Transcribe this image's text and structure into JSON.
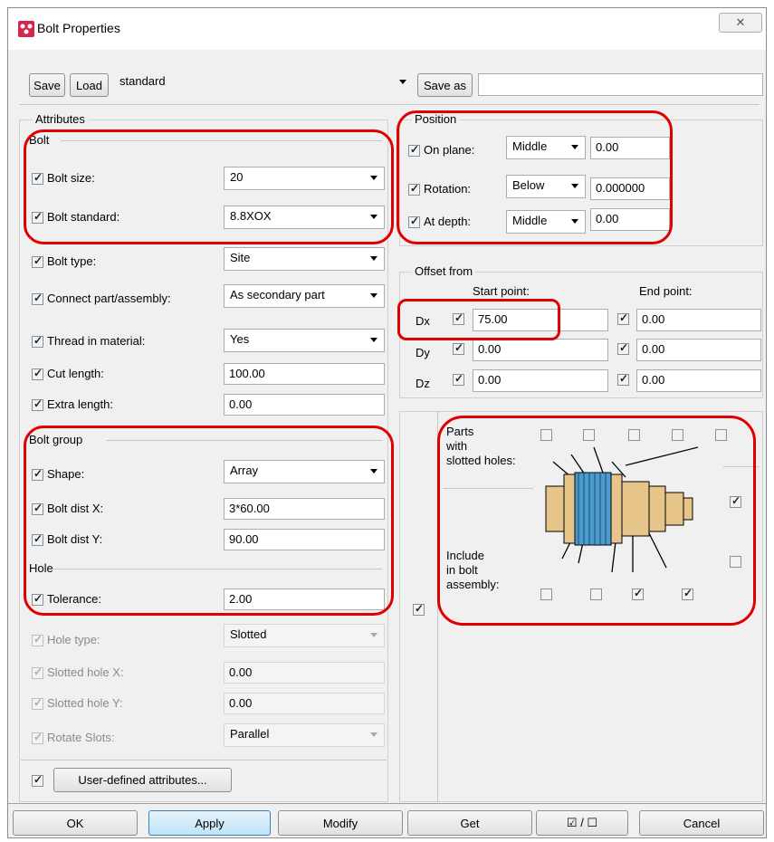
{
  "window": {
    "title": "Bolt Properties",
    "close_glyph": "✕"
  },
  "topbar": {
    "save": "Save",
    "load": "Load",
    "preset": "standard",
    "save_as": "Save as",
    "save_as_value": ""
  },
  "attributes": {
    "heading": "Attributes",
    "bolt_heading": "Bolt",
    "bolt_size_label": "Bolt size:",
    "bolt_size": "20",
    "bolt_standard_label": "Bolt standard:",
    "bolt_standard": "8.8XOX",
    "bolt_type_label": "Bolt type:",
    "bolt_type": "Site",
    "connect_label": "Connect part/assembly:",
    "connect": "As secondary part",
    "thread_label": "Thread in material:",
    "thread": "Yes",
    "cut_length_label": "Cut length:",
    "cut_length": "100.00",
    "extra_length_label": "Extra length:",
    "extra_length": "0.00",
    "group_heading": "Bolt group",
    "shape_label": "Shape:",
    "shape": "Array",
    "dist_x_label": "Bolt dist X:",
    "dist_x": "3*60.00",
    "dist_y_label": "Bolt dist Y:",
    "dist_y": "90.00",
    "hole_heading": "Hole",
    "tolerance_label": "Tolerance:",
    "tolerance": "2.00",
    "hole_type_label": "Hole type:",
    "hole_type": "Slotted",
    "slotted_x_label": "Slotted hole X:",
    "slotted_x": "0.00",
    "slotted_y_label": "Slotted hole Y:",
    "slotted_y": "0.00",
    "rotate_label": "Rotate Slots:",
    "rotate": "Parallel",
    "uda_button": "User-defined attributes..."
  },
  "position": {
    "heading": "Position",
    "on_plane_label": "On plane:",
    "on_plane": "Middle",
    "on_plane_value": "0.00",
    "rotation_label": "Rotation:",
    "rotation": "Below",
    "rotation_value": "0.000000",
    "at_depth_label": "At depth:",
    "at_depth": "Middle",
    "at_depth_value": "0.00"
  },
  "offset": {
    "heading": "Offset from",
    "start_label": "Start point:",
    "end_label": "End point:",
    "rows": [
      {
        "axis": "Dx",
        "start": "75.00",
        "end": "0.00"
      },
      {
        "axis": "Dy",
        "start": "0.00",
        "end": "0.00"
      },
      {
        "axis": "Dz",
        "start": "0.00",
        "end": "0.00"
      }
    ]
  },
  "assembly": {
    "parts_label": "Parts\nwith\nslotted holes:",
    "include_label": "Include\nin bolt\nassembly:",
    "graphic_icon": "bolt-assembly-diagram"
  },
  "footer": {
    "ok": "OK",
    "apply": "Apply",
    "modify": "Modify",
    "get": "Get",
    "toggle": "☑ / ☐",
    "cancel": "Cancel"
  },
  "colors": {
    "highlight": "#e00000",
    "accent": "#3c7fb1",
    "washer": "#4a9ccf",
    "bolt": "#e6c48a"
  }
}
